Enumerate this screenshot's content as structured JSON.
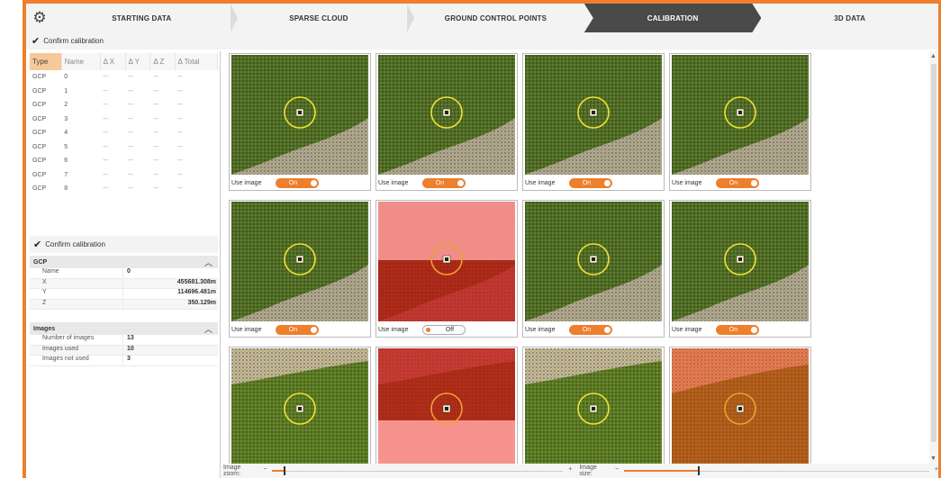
{
  "steps": [
    "STARTING DATA",
    "SPARSE CLOUD",
    "GROUND CONTROL POINTS",
    "CALIBRATION",
    "3D DATA"
  ],
  "confirm_label": "Confirm calibration",
  "table": {
    "headers": [
      "Type",
      "Name",
      "Δ X",
      "Δ Y",
      "Δ Z",
      "Δ Total"
    ],
    "rows": [
      [
        "GCP",
        "0",
        "---",
        "---",
        "---",
        "---"
      ],
      [
        "GCP",
        "1",
        "---",
        "---",
        "---",
        "---"
      ],
      [
        "GCP",
        "2",
        "---",
        "---",
        "---",
        "---"
      ],
      [
        "GCP",
        "3",
        "---",
        "---",
        "---",
        "---"
      ],
      [
        "GCP",
        "4",
        "---",
        "---",
        "---",
        "---"
      ],
      [
        "GCP",
        "5",
        "---",
        "---",
        "---",
        "---"
      ],
      [
        "GCP",
        "6",
        "---",
        "---",
        "---",
        "---"
      ],
      [
        "GCP",
        "7",
        "---",
        "---",
        "---",
        "---"
      ],
      [
        "GCP",
        "8",
        "---",
        "---",
        "---",
        "---"
      ]
    ]
  },
  "gcp_section": {
    "title": "GCP",
    "rows": [
      {
        "k": "Name",
        "v": "0"
      },
      {
        "k": "X",
        "v": "455681.308m"
      },
      {
        "k": "Y",
        "v": "114696.481m"
      },
      {
        "k": "Z",
        "v": "350.129m"
      }
    ]
  },
  "images_section": {
    "title": "Images",
    "rows": [
      {
        "k": "Number of images",
        "v": "13"
      },
      {
        "k": "Images used",
        "v": "10"
      },
      {
        "k": "Images not used",
        "v": "3"
      }
    ]
  },
  "use_image_label": "Use image",
  "toggle_on": "On",
  "toggle_off": "Off",
  "cards": [
    {
      "state": "on",
      "overlay": "none",
      "variant": "a"
    },
    {
      "state": "on",
      "overlay": "none",
      "variant": "a"
    },
    {
      "state": "on",
      "overlay": "none",
      "variant": "a"
    },
    {
      "state": "on",
      "overlay": "none",
      "variant": "a"
    },
    {
      "state": "on",
      "overlay": "none",
      "variant": "a"
    },
    {
      "state": "off",
      "overlay": "red",
      "variant": "a"
    },
    {
      "state": "on",
      "overlay": "none",
      "variant": "a"
    },
    {
      "state": "on",
      "overlay": "none",
      "variant": "a"
    },
    {
      "state": "on",
      "overlay": "none",
      "variant": "b"
    },
    {
      "state": "on",
      "overlay": "red",
      "variant": "b"
    },
    {
      "state": "on",
      "overlay": "none",
      "variant": "b"
    },
    {
      "state": "on",
      "overlay": "red2",
      "variant": "c"
    }
  ],
  "bottom": {
    "zoom_label": "Image zoom:",
    "size_label": "Image size:",
    "minus": "−",
    "plus": "+",
    "zoom_level": 0.04,
    "size_level": 0.24
  },
  "colors": {
    "accent": "#ee7f2d",
    "active_step": "#4a4a4a"
  }
}
